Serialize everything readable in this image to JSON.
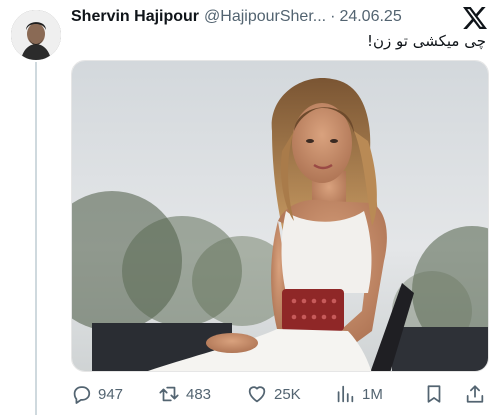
{
  "tweet": {
    "author_name": "Shervin Hajipour",
    "author_handle": "@HajipourSher...",
    "separator": "·",
    "date": "24.06.25",
    "text": "چی میکشی تو زن!"
  },
  "media": {
    "icon": "photo",
    "description_colors": {
      "sky": "#dfe3e6",
      "dress": "#f4f2ef",
      "belt": "#9a2a2a",
      "chair": "#2b2b2f"
    }
  },
  "actions": {
    "replies": {
      "icon": "reply-icon",
      "count": "947"
    },
    "retweets": {
      "icon": "retweet-icon",
      "count": "483"
    },
    "likes": {
      "icon": "heart-icon",
      "count": "25K"
    },
    "views": {
      "icon": "views-icon",
      "count": "1M"
    },
    "bookmark": {
      "icon": "bookmark-icon"
    },
    "share": {
      "icon": "share-icon"
    }
  },
  "colors": {
    "text": "#0f1419",
    "secondary": "#536471",
    "thread_line": "#cfd9de"
  }
}
